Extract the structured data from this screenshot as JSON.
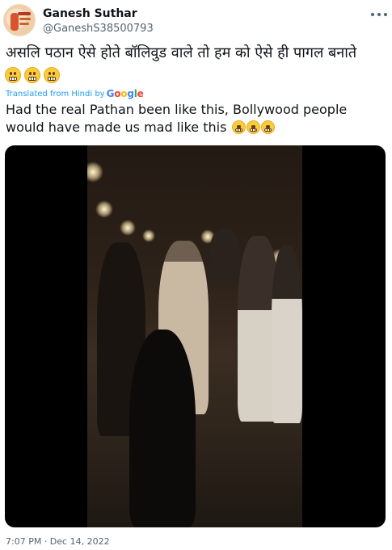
{
  "tweet": {
    "author_name": "Ganesh Suthar",
    "author_handle": "@GaneshS38500793",
    "text_original": "असलि पठान ऐसे होते बॉलिवुड वाले तो हम को ऐसे ही पागल बनाते",
    "original_emojis": [
      "grimacing-face",
      "grimacing-face",
      "grimacing-face"
    ],
    "translated_label": "Translated from Hindi by",
    "translator_brand": "Google",
    "text_translated": "Had the real Pathan been like this, Bollywood people would have made us mad like this",
    "translated_emojis": [
      "grimacing-face",
      "grimacing-face",
      "grimacing-face"
    ],
    "timestamp": "7:07 PM · Dec 14, 2022"
  },
  "icons": {
    "more": "more-horizontal-icon",
    "emoji": "grimacing-face-emoji"
  },
  "colors": {
    "text_primary": "#0f1419",
    "text_secondary": "#536471",
    "link": "#1d9bf0",
    "media_bg": "#000000"
  }
}
